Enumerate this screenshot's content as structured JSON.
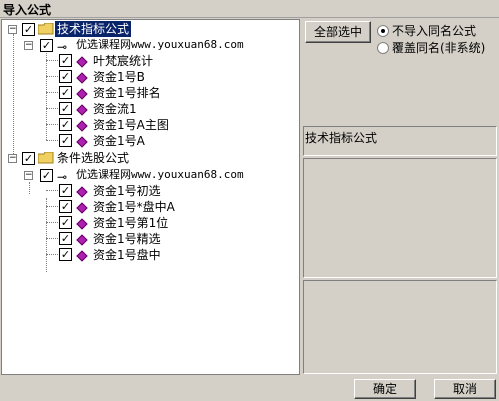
{
  "window": {
    "title": "导入公式"
  },
  "tree": {
    "groups": [
      {
        "label": "技术指标公式",
        "expander": "−",
        "checked": true,
        "source": "优选课程网www.youxuan68.com",
        "items": [
          "叶梵宸统计",
          "资金1号B",
          "资金1号排名",
          "资金流1",
          "资金1号A主图",
          "资金1号A"
        ]
      },
      {
        "label": "条件选股公式",
        "expander": "−",
        "checked": true,
        "source": "优选课程网www.youxuan68.com",
        "items": [
          "资金1号初选",
          "资金1号*盘中A",
          "资金1号第1位",
          "资金1号精选",
          "资金1号盘中"
        ]
      }
    ]
  },
  "options": {
    "select_all_label": "全部选中",
    "radio_no_import": "不导入同名公式",
    "radio_overwrite": "覆盖同名(非系统)",
    "selected_radio": "no_import"
  },
  "info": {
    "category": "技术指标公式"
  },
  "footer": {
    "ok_label": "确定",
    "cancel_label": "取消"
  },
  "colors": {
    "selection": "#0a246a",
    "gem": "#b020b0",
    "folder": "#f0d060"
  }
}
